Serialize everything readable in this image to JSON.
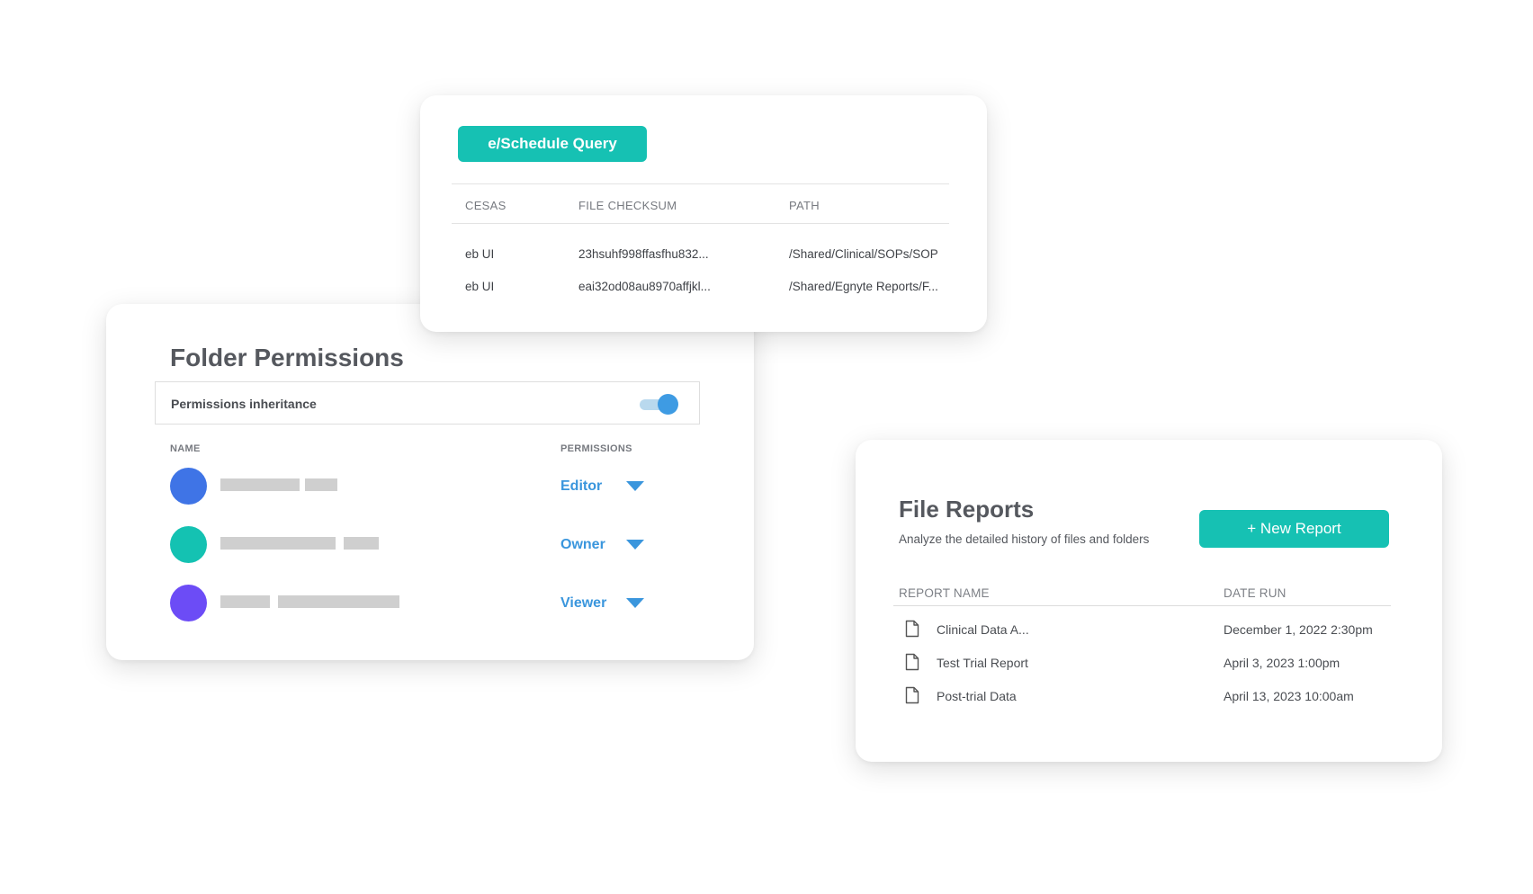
{
  "query_card": {
    "button_label": "e/Schedule Query",
    "columns": [
      "CESAS",
      "FILE CHECKSUM",
      "PATH"
    ],
    "rows": [
      [
        "eb UI",
        "23hsuhf998ffasfhu832...",
        "/Shared/Clinical/SOPs/SOP"
      ],
      [
        "eb UI",
        "eai32od08au8970affjkl...",
        "/Shared/Egnyte Reports/F..."
      ]
    ]
  },
  "permissions_card": {
    "title": "Folder Permissions",
    "inheritance_label": "Permissions inheritance",
    "inheritance_enabled": true,
    "columns": {
      "name": "NAME",
      "permissions": "PERMISSIONS"
    },
    "users": [
      {
        "avatar_color": "#3f74e6",
        "permission": "Editor"
      },
      {
        "avatar_color": "#14c2b2",
        "permission": "Owner"
      },
      {
        "avatar_color": "#6c4cf6",
        "permission": "Viewer"
      }
    ]
  },
  "reports_card": {
    "title": "File Reports",
    "subtitle": "Analyze the detailed history of files and folders",
    "new_button": "+ New Report",
    "columns": {
      "name": "REPORT NAME",
      "date": "DATE RUN"
    },
    "rows": [
      {
        "icon": "document-icon",
        "name": "Clinical Data A...",
        "date": "December 1, 2022 2:30pm"
      },
      {
        "icon": "document-icon",
        "name": "Test Trial Report",
        "date": "April 3, 2023 1:00pm"
      },
      {
        "icon": "document-icon",
        "name": "Post-trial Data",
        "date": "April 13, 2023 10:00am"
      }
    ]
  },
  "colors": {
    "accent_teal": "#16c1b3",
    "link_blue": "#3a96dd",
    "placeholder_gray": "#cfcfcf"
  }
}
